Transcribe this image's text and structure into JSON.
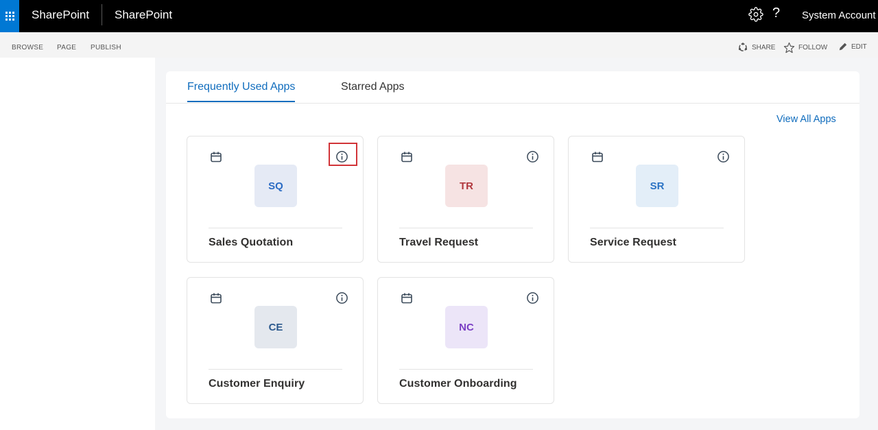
{
  "suitebar": {
    "brand": "SharePoint",
    "site_title": "SharePoint",
    "help": "?",
    "account": "System Account"
  },
  "ribbon": {
    "tabs": [
      "BROWSE",
      "PAGE",
      "PUBLISH"
    ],
    "actions": {
      "share": "SHARE",
      "follow": "FOLLOW",
      "edit": "EDIT"
    }
  },
  "main": {
    "tabs": [
      {
        "label": "Frequently Used Apps",
        "active": true
      },
      {
        "label": "Starred Apps",
        "active": false
      }
    ],
    "view_all": "View All Apps",
    "apps": [
      {
        "abbr": "SQ",
        "name": "Sales Quotation",
        "tile_bg": "#e5eaf5",
        "tile_fg": "#2b6cc4",
        "highlighted": true
      },
      {
        "abbr": "TR",
        "name": "Travel Request",
        "tile_bg": "#f6e3e3",
        "tile_fg": "#b1383e",
        "highlighted": false
      },
      {
        "abbr": "SR",
        "name": "Service Request",
        "tile_bg": "#e3eef8",
        "tile_fg": "#2b73c4",
        "highlighted": false
      },
      {
        "abbr": "CE",
        "name": "Customer Enquiry",
        "tile_bg": "#e4e8ee",
        "tile_fg": "#2d5a8e",
        "highlighted": false
      },
      {
        "abbr": "NC",
        "name": "Customer Onboarding",
        "tile_bg": "#ece5f8",
        "tile_fg": "#7b3fc4",
        "highlighted": false
      }
    ]
  },
  "colors": {
    "accent": "#0f6cbd",
    "suitebar": "#000000",
    "waffle": "#0078d4",
    "highlight_box": "#d13438"
  }
}
